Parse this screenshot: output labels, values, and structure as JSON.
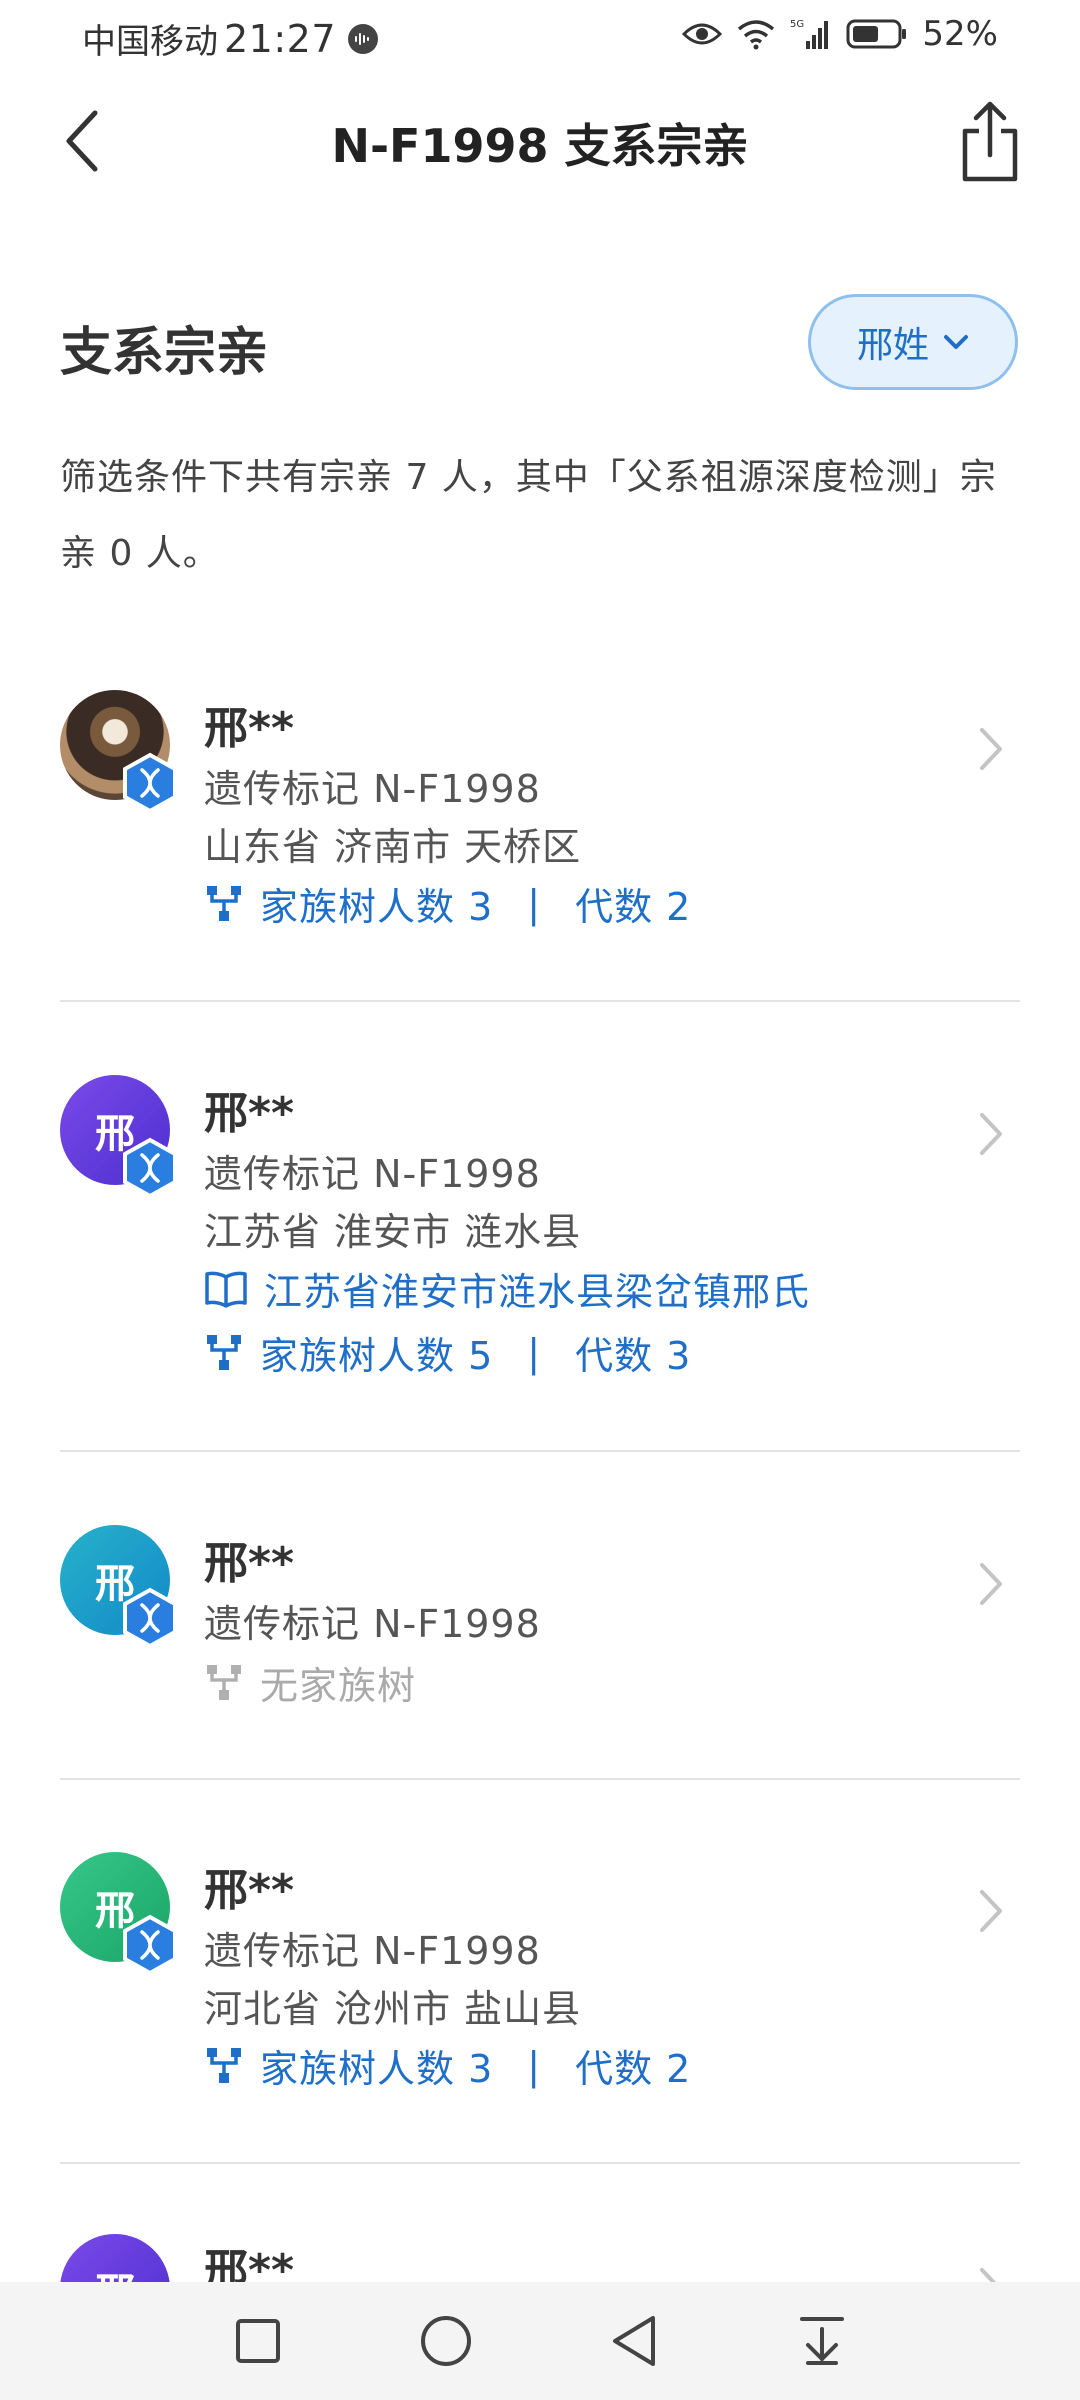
{
  "status_bar": {
    "carrier": "中国移动",
    "time": "21:27",
    "battery": "52%"
  },
  "navbar": {
    "title": "N-F1998 支系宗亲"
  },
  "section": {
    "title": "支系宗亲",
    "filter_label": "邢姓"
  },
  "summary": "筛选条件下共有宗亲 7 人，其中「父系祖源深度检测」宗亲 0 人。",
  "relatives": [
    {
      "name": "邢**",
      "avatar_text": "",
      "marker": "遗传标记 N-F1998",
      "location": "山东省 济南市 天桥区",
      "genealogy": "",
      "tree_count": "家族树人数 3",
      "tree_gen": "代数 2",
      "no_tree": ""
    },
    {
      "name": "邢**",
      "avatar_text": "邢",
      "marker": "遗传标记 N-F1998",
      "location": "江苏省 淮安市 涟水县",
      "genealogy": "江苏省淮安市涟水县梁岔镇邢氏",
      "tree_count": "家族树人数 5",
      "tree_gen": "代数 3",
      "no_tree": ""
    },
    {
      "name": "邢**",
      "avatar_text": "邢",
      "marker": "遗传标记 N-F1998",
      "location": "",
      "genealogy": "",
      "tree_count": "",
      "tree_gen": "",
      "no_tree": "无家族树"
    },
    {
      "name": "邢**",
      "avatar_text": "邢",
      "marker": "遗传标记 N-F1998",
      "location": "河北省 沧州市 盐山县",
      "genealogy": "",
      "tree_count": "家族树人数 3",
      "tree_gen": "代数 2",
      "no_tree": ""
    },
    {
      "name": "邢**",
      "avatar_text": "邢"
    }
  ],
  "separator": "|",
  "colors": {
    "accent": "#1f6fc9",
    "filter_bg": "#e5f1fd"
  },
  "icons": [
    "back-icon",
    "share-icon",
    "chevron-down-icon",
    "dna-badge-icon",
    "family-tree-icon",
    "book-icon",
    "chevron-right-icon",
    "square-nav-icon",
    "circle-nav-icon",
    "triangle-nav-icon",
    "download-nav-icon"
  ]
}
